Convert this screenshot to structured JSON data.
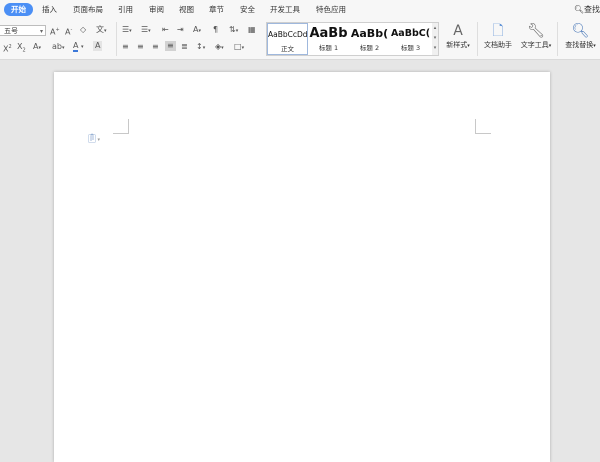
{
  "menu": {
    "tabs": [
      "开始",
      "插入",
      "页面布局",
      "引用",
      "审阅",
      "视图",
      "章节",
      "安全",
      "开发工具",
      "特色应用"
    ],
    "active_tab": "开始",
    "right_label": "查找"
  },
  "ribbon": {
    "font_size_value": "五号",
    "styles": [
      {
        "sample": "AaBbCcDd",
        "name": "正文"
      },
      {
        "sample": "AaBb",
        "name": "标题 1"
      },
      {
        "sample": "AaBb(",
        "name": "标题 2"
      },
      {
        "sample": "AaBbC(",
        "name": "标题 3"
      }
    ],
    "new_style_label": "新样式",
    "doc_helper_label": "文档助手",
    "text_tools_label": "文字工具",
    "find_replace_label": "查找替换"
  },
  "colors": {
    "accent": "#4b8ff5",
    "font_color_underline": "#3c78d8"
  }
}
